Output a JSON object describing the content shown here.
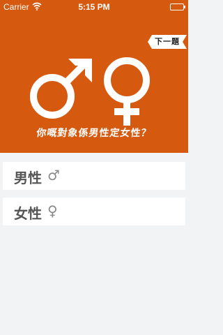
{
  "status_bar": {
    "carrier": "Carrier",
    "time": "5:15 PM"
  },
  "header": {
    "next_button_label": "下一題",
    "question": "你嘅對象係男性定女性？"
  },
  "options": [
    {
      "label": "男性",
      "symbol": "♂"
    },
    {
      "label": "女性",
      "symbol": "♀"
    }
  ],
  "colors": {
    "accent": "#d55a10",
    "background": "#f2f3f4"
  }
}
